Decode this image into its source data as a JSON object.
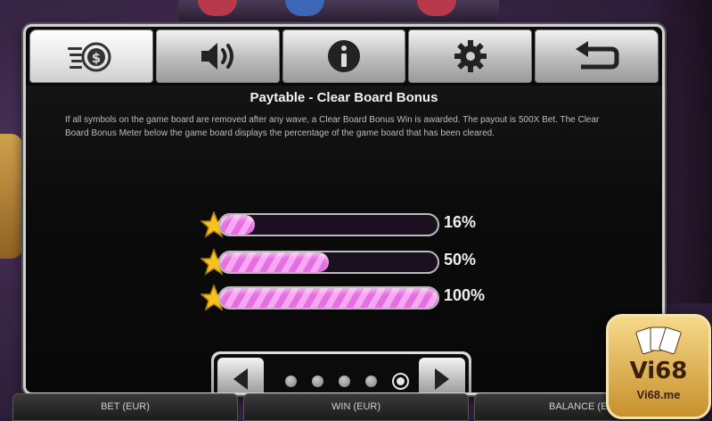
{
  "tabs": [
    {
      "name": "paytable",
      "icon": "coins-icon",
      "active": true
    },
    {
      "name": "sound",
      "icon": "speaker-icon",
      "active": false
    },
    {
      "name": "info",
      "icon": "info-icon",
      "active": false
    },
    {
      "name": "settings",
      "icon": "gear-icon",
      "active": false
    },
    {
      "name": "back",
      "icon": "return-arrow-icon",
      "active": false
    }
  ],
  "paytable": {
    "title": "Paytable - Clear Board Bonus",
    "description": "If all symbols on the game board are removed after any wave, a Clear Board Bonus Win is awarded.  The payout is 500X Bet.  The Clear Board Bonus Meter below the game board displays the percentage of the game board that has been cleared."
  },
  "meters": [
    {
      "label": "16%",
      "fill": 0.16
    },
    {
      "label": "50%",
      "fill": 0.5
    },
    {
      "label": "100%",
      "fill": 1.0
    }
  ],
  "pager": {
    "pages": 5,
    "current": 5
  },
  "bottom_bar": {
    "bet_label": "BET (EUR)",
    "win_label": "WIN (EUR)",
    "balance_label": "BALANCE (EUR)"
  },
  "logo": {
    "main": "Vi68",
    "sub": "Vi68.me"
  },
  "colors": {
    "fill_pink": "#e56fe0",
    "star_yellow": "#f6c21c",
    "panel_bg": "#0a0a0a"
  }
}
